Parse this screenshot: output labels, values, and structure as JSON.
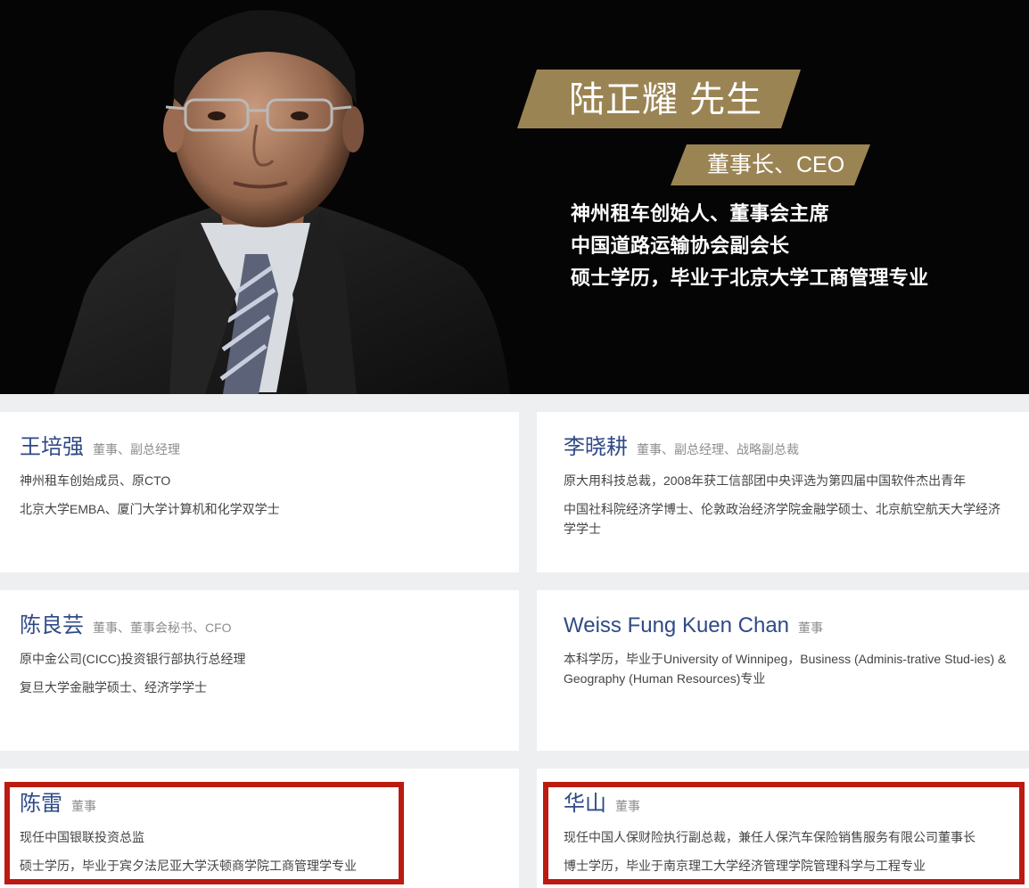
{
  "hero": {
    "name": "陆正耀 先生",
    "title": "董事长、CEO",
    "bio": [
      "神州租车创始人、董事会主席",
      "中国道路运输协会副会长",
      "硕士学历，毕业于北京大学工商管理专业"
    ]
  },
  "members": [
    {
      "name": "王培强",
      "role": "董事、副总经理",
      "lines": [
        "神州租车创始成员、原CTO",
        "北京大学EMBA、厦门大学计算机和化学双学士"
      ]
    },
    {
      "name": "李晓耕",
      "role": "董事、副总经理、战略副总裁",
      "lines": [
        "原大用科技总裁，2008年获工信部团中央评选为第四届中国软件杰出青年",
        "中国社科院经济学博士、伦敦政治经济学院金融学硕士、北京航空航天大学经济学学士"
      ]
    },
    {
      "name": "陈良芸",
      "role": "董事、董事会秘书、CFO",
      "lines": [
        "原中金公司(CICC)投资银行部执行总经理",
        "复旦大学金融学硕士、经济学学士"
      ]
    },
    {
      "name": "Weiss Fung Kuen Chan",
      "role": "董事",
      "lines": [
        "本科学历，毕业于University of Winnipeg，Business (Adminis-trative Stud-ies) & Geography (Human Resources)专业"
      ]
    },
    {
      "name": "陈雷",
      "role": "董事",
      "lines": [
        "现任中国银联投资总监",
        "硕士学历，毕业于宾夕法尼亚大学沃顿商学院工商管理学专业"
      ]
    },
    {
      "name": "华山",
      "role": "董事",
      "lines": [
        "现任中国人保财险执行副总裁，兼任人保汽车保险销售服务有限公司董事长",
        "博士学历，毕业于南京理工大学经济管理学院管理科学与工程专业"
      ]
    }
  ],
  "colors": {
    "gold": "#9b8454",
    "name_blue": "#2f4a86",
    "highlight_red": "#bb1b10"
  }
}
